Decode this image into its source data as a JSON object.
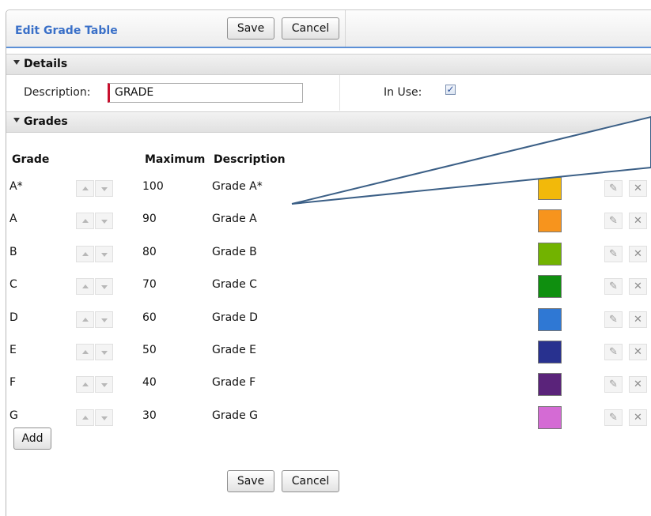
{
  "title": "Edit Grade Table",
  "toolbar": {
    "save_label": "Save",
    "cancel_label": "Cancel"
  },
  "details": {
    "section_label": "Details",
    "description_label": "Description:",
    "description_value": "GRADE",
    "in_use_label": "In Use:",
    "in_use_checked": true
  },
  "grades": {
    "section_label": "Grades",
    "col_grade": "Grade",
    "col_maximum": "Maximum",
    "col_description": "Description",
    "rows": [
      {
        "grade": "A*",
        "maximum": "100",
        "description": "Grade A*",
        "color": "#f2b90a"
      },
      {
        "grade": "A",
        "maximum": "90",
        "description": "Grade A",
        "color": "#f7941d"
      },
      {
        "grade": "B",
        "maximum": "80",
        "description": "Grade B",
        "color": "#72b300"
      },
      {
        "grade": "C",
        "maximum": "70",
        "description": "Grade C",
        "color": "#0f8f0f"
      },
      {
        "grade": "D",
        "maximum": "60",
        "description": "Grade D",
        "color": "#2f78d4"
      },
      {
        "grade": "E",
        "maximum": "50",
        "description": "Grade E",
        "color": "#28318f"
      },
      {
        "grade": "F",
        "maximum": "40",
        "description": "Grade F",
        "color": "#5a237a"
      },
      {
        "grade": "G",
        "maximum": "30",
        "description": "Grade G",
        "color": "#d46bd4"
      }
    ],
    "add_label": "Add"
  },
  "footer": {
    "save_label": "Save",
    "cancel_label": "Cancel"
  }
}
